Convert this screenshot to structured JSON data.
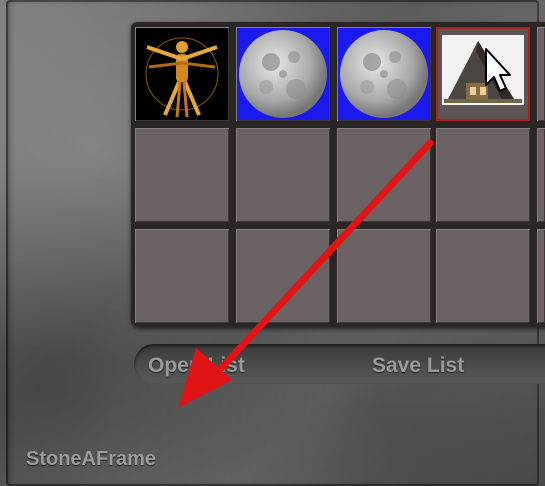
{
  "grid": {
    "items": [
      {
        "name": "vitruvian-man",
        "kind": "image"
      },
      {
        "name": "moon",
        "kind": "image"
      },
      {
        "name": "moon",
        "kind": "image"
      },
      {
        "name": "stone-a-frame-house",
        "kind": "image",
        "selected": true
      },
      {
        "name": "empty"
      },
      {
        "name": "empty"
      },
      {
        "name": "empty"
      },
      {
        "name": "empty"
      },
      {
        "name": "empty"
      },
      {
        "name": "empty"
      },
      {
        "name": "empty"
      },
      {
        "name": "empty"
      }
    ],
    "selection_color": "#b01e1e"
  },
  "buttons": {
    "open_list": "Open List",
    "save_list": "Save List"
  },
  "selected_item_label": "StoneAFrame",
  "annotation": {
    "type": "arrow",
    "color": "#e01414"
  }
}
